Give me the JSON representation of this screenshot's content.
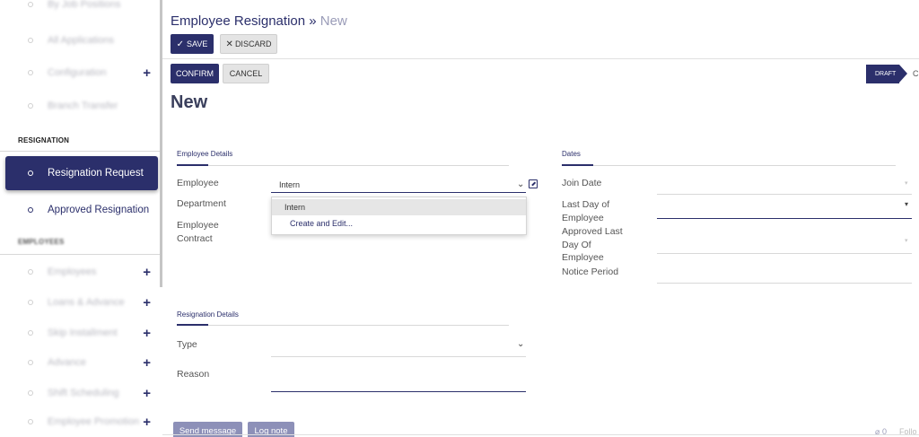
{
  "sidebar": {
    "top_items": [
      {
        "label": "By Job Positions",
        "has_plus": false
      },
      {
        "label": "All Applications",
        "has_plus": false
      },
      {
        "label": "Configuration",
        "has_plus": true
      },
      {
        "label": "Branch Transfer",
        "has_plus": false
      }
    ],
    "resignation_section": "RESIGNATION",
    "resignation_items": [
      {
        "label": "Resignation Request",
        "active": true
      },
      {
        "label": "Approved Resignation",
        "active": false
      }
    ],
    "employees_section": "EMPLOYEES",
    "employee_items": [
      {
        "label": "Employees",
        "has_plus": true
      },
      {
        "label": "Loans & Advance",
        "has_plus": true
      },
      {
        "label": "Skip Installment",
        "has_plus": true
      },
      {
        "label": "Advance",
        "has_plus": true
      },
      {
        "label": "Shift Scheduling",
        "has_plus": true
      },
      {
        "label": "Employee Promotion",
        "has_plus": true
      }
    ],
    "plus_symbol": "+"
  },
  "breadcrumb": {
    "parent": "Employee Resignation",
    "separator": "»",
    "current": "New"
  },
  "toolbar": {
    "save_icon": "✓",
    "save_label": "SAVE",
    "discard_icon": "✕",
    "discard_label": "DISCARD"
  },
  "statusbar": {
    "confirm_label": "CONFIRM",
    "cancel_label": "CANCEL",
    "draft_label": "DRAFT",
    "next_stage_glimpse": "C"
  },
  "record_title": "New",
  "employee_details": {
    "group_title": "Employee Details",
    "employee_label": "Employee",
    "employee_value": "Intern",
    "department_label": "Department",
    "contract_label_1": "Employee",
    "contract_label_2": "Contract"
  },
  "dropdown": {
    "items": [
      "Intern"
    ],
    "create_edit_label": "Create and Edit..."
  },
  "dates": {
    "group_title": "Dates",
    "join_date_label": "Join Date",
    "last_day_label_1": "Last Day of",
    "last_day_label_2": "Employee",
    "approved_label_1": "Approved Last",
    "approved_label_2": "Day Of",
    "approved_label_3": "Employee",
    "notice_period_label": "Notice Period"
  },
  "resignation_details": {
    "group_title": "Resignation Details",
    "type_label": "Type",
    "reason_label": "Reason"
  },
  "chatter": {
    "send_message_label": "Send message",
    "log_note_label": "Log note",
    "attachment_count": "0",
    "follow_label": "Follo"
  },
  "colors": {
    "accent": "#2b2f6b",
    "chatter_button": "#8d90b8"
  }
}
